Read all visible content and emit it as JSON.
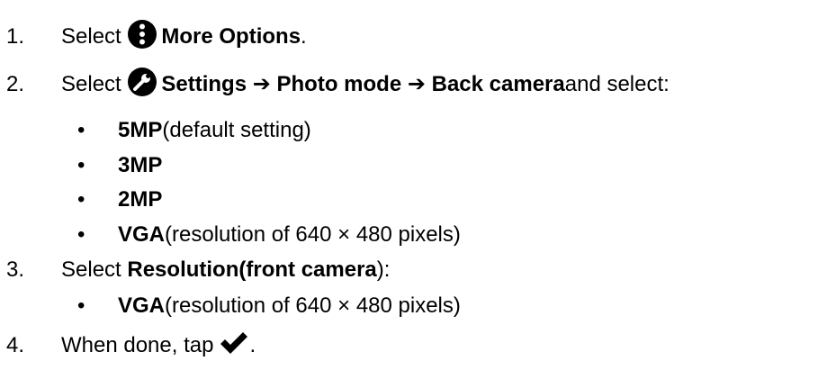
{
  "steps": [
    {
      "number": "1.",
      "select_label": "Select",
      "icon": "more-options-icon",
      "target": "More Options",
      "trailing": "."
    },
    {
      "number": "2.",
      "select_label": "Select",
      "icon": "settings-wrench-icon",
      "path": [
        "Settings",
        "Photo mode",
        "Back camera"
      ],
      "arrow": "➔",
      "trailing": " and select:",
      "options": [
        {
          "name": "5MP",
          "note": " (default setting)"
        },
        {
          "name": "3MP",
          "note": ""
        },
        {
          "name": "2MP",
          "note": ""
        },
        {
          "name": "VGA",
          "note": " (resolution of 640 × 480 pixels)"
        }
      ]
    },
    {
      "number": "3.",
      "select_label": "Select",
      "target_bold_1": "Resolution",
      "target_paren_open": " (",
      "target_bold_2": "front camera",
      "target_paren_close": "):",
      "options": [
        {
          "name": "VGA",
          "note": " (resolution of 640 × 480 pixels)"
        }
      ]
    },
    {
      "number": "4.",
      "text": "When done, tap",
      "icon": "checkmark-icon",
      "trailing": "."
    }
  ],
  "bullet_char": "•",
  "colors": {
    "text": "#000000",
    "icon_fill": "#000000"
  }
}
